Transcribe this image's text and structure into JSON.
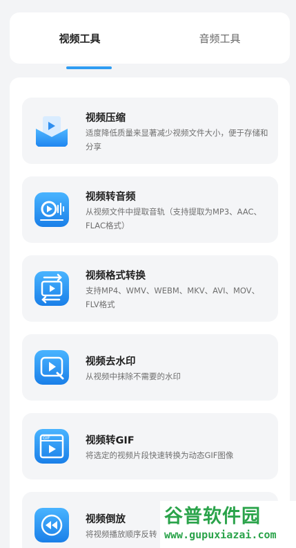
{
  "tabs": [
    {
      "label": "视频工具",
      "active": true
    },
    {
      "label": "音频工具",
      "active": false
    }
  ],
  "accent_color": "#2f9cf2",
  "tools": [
    {
      "title": "视频压缩",
      "desc": "适度降低质量来显著减少视频文件大小，便于存储和分享",
      "icon": "video-compress-icon"
    },
    {
      "title": "视频转音频",
      "desc": "从视频文件中提取音轨（支持提取为MP3、AAC、FLAC格式）",
      "icon": "video-to-audio-icon"
    },
    {
      "title": "视频格式转换",
      "desc": "支持MP4、WMV、WEBM、MKV、AVI、MOV、FLV格式",
      "icon": "format-convert-icon"
    },
    {
      "title": "视频去水印",
      "desc": "从视频中抹除不需要的水印",
      "icon": "remove-watermark-icon"
    },
    {
      "title": "视频转GIF",
      "desc": "将选定的视频片段快速转换为动态GIF图像",
      "icon": "video-to-gif-icon",
      "badge": "GIF"
    },
    {
      "title": "视频倒放",
      "desc": "将视频播放顺序反转",
      "icon": "video-reverse-icon"
    }
  ],
  "watermark": {
    "logo": "谷普软件园",
    "url": "www.gupuxiazai.com"
  }
}
